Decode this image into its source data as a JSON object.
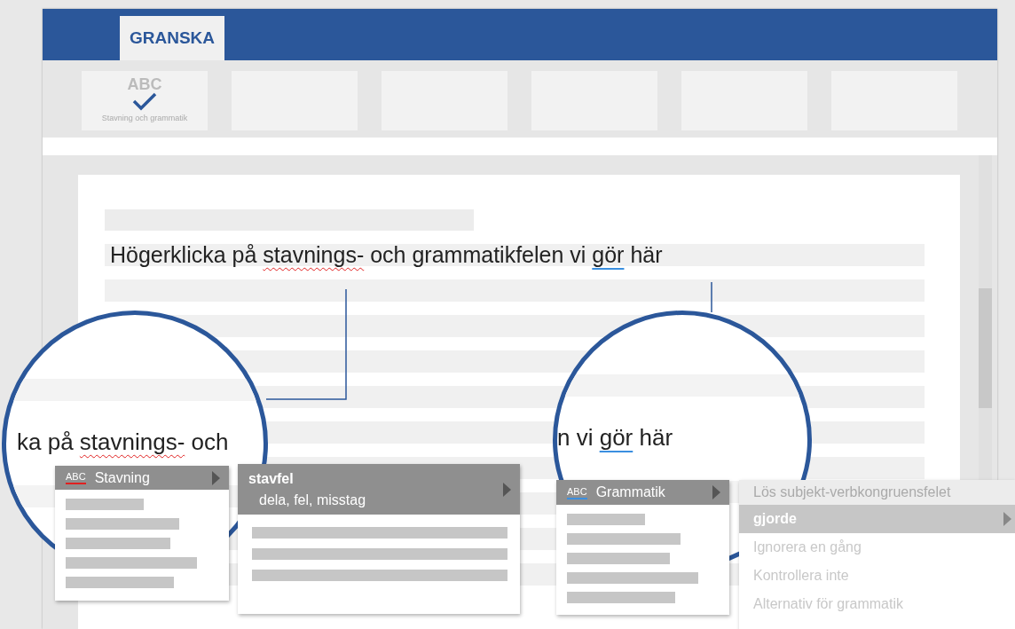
{
  "ribbon": {
    "tabs": [
      {
        "label": "GRANSKA",
        "selected": true
      }
    ],
    "buttons": [
      {
        "icon_text": "ABC",
        "label": "Stavning och grammatik"
      }
    ]
  },
  "document": {
    "sentence": [
      {
        "text": "Högerklicka på ",
        "spelling_error": false,
        "grammar_error": false
      },
      {
        "text": "stavnings-",
        "spelling_error": true,
        "grammar_error": false
      },
      {
        "text": " och grammatikfelen vi ",
        "spelling_error": false,
        "grammar_error": false
      },
      {
        "text": "gör",
        "spelling_error": false,
        "grammar_error": true
      },
      {
        "text": " här",
        "spelling_error": false,
        "grammar_error": false
      }
    ]
  },
  "magnifiers": [
    {
      "segments": [
        {
          "text": "ka på ",
          "spelling_error": false,
          "grammar_error": false
        },
        {
          "text": "stavnings-",
          "spelling_error": true,
          "grammar_error": false
        },
        {
          "text": " och",
          "spelling_error": false,
          "grammar_error": false
        }
      ]
    },
    {
      "segments": [
        {
          "text": "n vi ",
          "spelling_error": false,
          "grammar_error": false
        },
        {
          "text": "gör",
          "spelling_error": false,
          "grammar_error": true
        },
        {
          "text": " här",
          "spelling_error": false,
          "grammar_error": false
        }
      ]
    }
  ],
  "menus": [
    {
      "header": {
        "icon_text": "ABC",
        "color": "#e02020",
        "label": "Stavning",
        "selected": true
      }
    },
    {
      "header": {
        "label": "stavfel",
        "detail": "dela, fel, misstag",
        "selected": true
      }
    },
    {
      "header": {
        "icon_text": "ABC",
        "color": "#3b8fe0",
        "label": "Grammatik",
        "selected": true
      }
    },
    {
      "items": [
        {
          "label": "Lös subjekt-verbkongruensfelet",
          "kind": "heading",
          "selected": false
        },
        {
          "label": "gjorde",
          "kind": "suggestion",
          "selected": true
        },
        {
          "label": "Ignorera en gång",
          "kind": "action",
          "selected": false
        },
        {
          "label": "Kontrollera inte",
          "kind": "action",
          "selected": false
        },
        {
          "label": "Alternativ för grammatik",
          "kind": "action",
          "selected": false
        }
      ]
    }
  ]
}
